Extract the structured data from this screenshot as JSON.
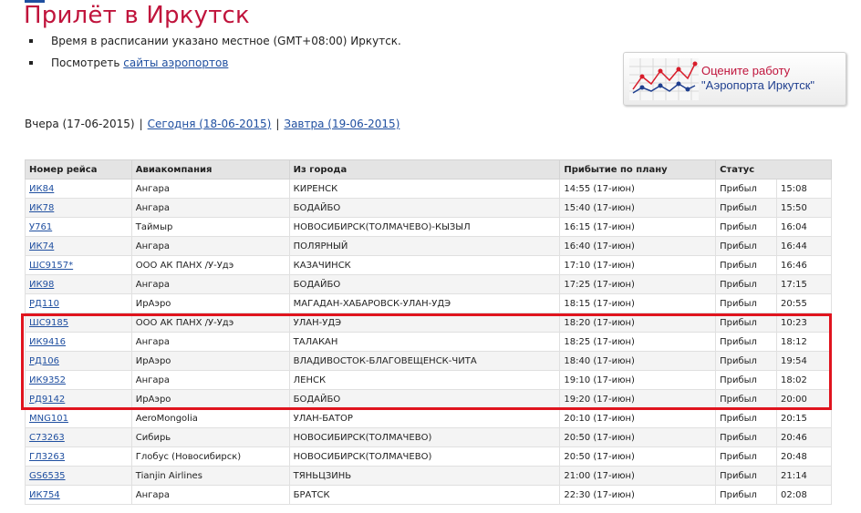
{
  "page": {
    "title": "Прилёт в Иркутск",
    "notes": {
      "timezone": "Время в расписании указано местное (GMT+08:00) Иркутск.",
      "airports_prefix": "Посмотреть",
      "airports_link": "сайты аэропортов"
    }
  },
  "banner": {
    "line1": "Оцените работу",
    "line2": "\"Аэропорта Иркутск\""
  },
  "daynav": {
    "yesterday": "Вчера (17-06-2015)",
    "today": "Сегодня (18-06-2015)",
    "tomorrow": "Завтра (19-06-2015)",
    "separator": "|"
  },
  "table": {
    "headers": [
      "Номер рейса",
      "Авиакомпания",
      "Из города",
      "Прибытие по плану",
      "Статус"
    ],
    "rows": [
      {
        "flight": "ИК84",
        "airline": "Ангара",
        "from": "КИРЕНСК",
        "planned": "14:55 (17-июн)",
        "status": "Прибыл",
        "actual": "15:08"
      },
      {
        "flight": "ИК78",
        "airline": "Ангара",
        "from": "БОДАЙБО",
        "planned": "15:40 (17-июн)",
        "status": "Прибыл",
        "actual": "15:50"
      },
      {
        "flight": "У761",
        "airline": "Таймыр",
        "from": "НОВОСИБИРСК(ТОЛМАЧЕВО)-КЫЗЫЛ",
        "planned": "16:15 (17-июн)",
        "status": "Прибыл",
        "actual": "16:04"
      },
      {
        "flight": "ИК74",
        "airline": "Ангара",
        "from": "ПОЛЯРНЫЙ",
        "planned": "16:40 (17-июн)",
        "status": "Прибыл",
        "actual": "16:44"
      },
      {
        "flight": "ШС9157*",
        "airline": "ООО АК ПАНХ /У-Удэ",
        "from": "КАЗАЧИНСК",
        "planned": "17:10 (17-июн)",
        "status": "Прибыл",
        "actual": "16:46"
      },
      {
        "flight": "ИК98",
        "airline": "Ангара",
        "from": "БОДАЙБО",
        "planned": "17:25 (17-июн)",
        "status": "Прибыл",
        "actual": "17:15"
      },
      {
        "flight": "РД110",
        "airline": "ИрАэро",
        "from": "МАГАДАН-ХАБАРОВСК-УЛАН-УДЭ",
        "planned": "18:15 (17-июн)",
        "status": "Прибыл",
        "actual": "20:55"
      },
      {
        "flight": "ШС9185",
        "airline": "ООО АК ПАНХ /У-Удэ",
        "from": "УЛАН-УДЭ",
        "planned": "18:20 (17-июн)",
        "status": "Прибыл",
        "actual": "10:23"
      },
      {
        "flight": "ИК9416",
        "airline": "Ангара",
        "from": "ТАЛАКАН",
        "planned": "18:25 (17-июн)",
        "status": "Прибыл",
        "actual": "18:12"
      },
      {
        "flight": "РД106",
        "airline": "ИрАэро",
        "from": "ВЛАДИВОСТОК-БЛАГОВЕЩЕНСК-ЧИТА",
        "planned": "18:40 (17-июн)",
        "status": "Прибыл",
        "actual": "19:54"
      },
      {
        "flight": "ИК9352",
        "airline": "Ангара",
        "from": "ЛЕНСК",
        "planned": "19:10 (17-июн)",
        "status": "Прибыл",
        "actual": "18:02"
      },
      {
        "flight": "РД9142",
        "airline": "ИрАэро",
        "from": "БОДАЙБО",
        "planned": "19:20 (17-июн)",
        "status": "Прибыл",
        "actual": "20:00"
      },
      {
        "flight": "MNG101",
        "airline": "AeroMongolia",
        "from": "УЛАН-БАТОР",
        "planned": "20:10 (17-июн)",
        "status": "Прибыл",
        "actual": "20:15"
      },
      {
        "flight": "С73263",
        "airline": "Сибирь",
        "from": "НОВОСИБИРСК(ТОЛМАЧЕВО)",
        "planned": "20:50 (17-июн)",
        "status": "Прибыл",
        "actual": "20:46"
      },
      {
        "flight": "ГЛ3263",
        "airline": "Глобус (Новосибирск)",
        "from": "НОВОСИБИРСК(ТОЛМАЧЕВО)",
        "planned": "20:50 (17-июн)",
        "status": "Прибыл",
        "actual": "20:48"
      },
      {
        "flight": "GS6535",
        "airline": "Tianjin Airlines",
        "from": "ТЯНЬЦЗИНЬ",
        "planned": "21:00 (17-июн)",
        "status": "Прибыл",
        "actual": "21:14"
      },
      {
        "flight": "ИК754",
        "airline": "Ангара",
        "from": "БРАТСК",
        "planned": "22:30 (17-июн)",
        "status": "Прибыл",
        "actual": "02:08"
      }
    ]
  },
  "colors": {
    "title": "#c0143c",
    "link": "#1f4fa0",
    "highlight": "#e0141e"
  }
}
